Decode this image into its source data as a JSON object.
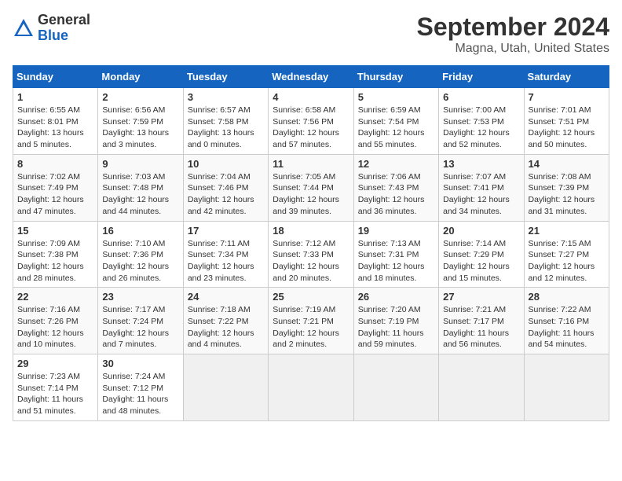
{
  "header": {
    "logo_general": "General",
    "logo_blue": "Blue",
    "month": "September 2024",
    "location": "Magna, Utah, United States"
  },
  "weekdays": [
    "Sunday",
    "Monday",
    "Tuesday",
    "Wednesday",
    "Thursday",
    "Friday",
    "Saturday"
  ],
  "weeks": [
    [
      {
        "day": "1",
        "sunrise": "6:55 AM",
        "sunset": "8:01 PM",
        "daylight": "13 hours and 5 minutes."
      },
      {
        "day": "2",
        "sunrise": "6:56 AM",
        "sunset": "7:59 PM",
        "daylight": "13 hours and 3 minutes."
      },
      {
        "day": "3",
        "sunrise": "6:57 AM",
        "sunset": "7:58 PM",
        "daylight": "13 hours and 0 minutes."
      },
      {
        "day": "4",
        "sunrise": "6:58 AM",
        "sunset": "7:56 PM",
        "daylight": "12 hours and 57 minutes."
      },
      {
        "day": "5",
        "sunrise": "6:59 AM",
        "sunset": "7:54 PM",
        "daylight": "12 hours and 55 minutes."
      },
      {
        "day": "6",
        "sunrise": "7:00 AM",
        "sunset": "7:53 PM",
        "daylight": "12 hours and 52 minutes."
      },
      {
        "day": "7",
        "sunrise": "7:01 AM",
        "sunset": "7:51 PM",
        "daylight": "12 hours and 50 minutes."
      }
    ],
    [
      {
        "day": "8",
        "sunrise": "7:02 AM",
        "sunset": "7:49 PM",
        "daylight": "12 hours and 47 minutes."
      },
      {
        "day": "9",
        "sunrise": "7:03 AM",
        "sunset": "7:48 PM",
        "daylight": "12 hours and 44 minutes."
      },
      {
        "day": "10",
        "sunrise": "7:04 AM",
        "sunset": "7:46 PM",
        "daylight": "12 hours and 42 minutes."
      },
      {
        "day": "11",
        "sunrise": "7:05 AM",
        "sunset": "7:44 PM",
        "daylight": "12 hours and 39 minutes."
      },
      {
        "day": "12",
        "sunrise": "7:06 AM",
        "sunset": "7:43 PM",
        "daylight": "12 hours and 36 minutes."
      },
      {
        "day": "13",
        "sunrise": "7:07 AM",
        "sunset": "7:41 PM",
        "daylight": "12 hours and 34 minutes."
      },
      {
        "day": "14",
        "sunrise": "7:08 AM",
        "sunset": "7:39 PM",
        "daylight": "12 hours and 31 minutes."
      }
    ],
    [
      {
        "day": "15",
        "sunrise": "7:09 AM",
        "sunset": "7:38 PM",
        "daylight": "12 hours and 28 minutes."
      },
      {
        "day": "16",
        "sunrise": "7:10 AM",
        "sunset": "7:36 PM",
        "daylight": "12 hours and 26 minutes."
      },
      {
        "day": "17",
        "sunrise": "7:11 AM",
        "sunset": "7:34 PM",
        "daylight": "12 hours and 23 minutes."
      },
      {
        "day": "18",
        "sunrise": "7:12 AM",
        "sunset": "7:33 PM",
        "daylight": "12 hours and 20 minutes."
      },
      {
        "day": "19",
        "sunrise": "7:13 AM",
        "sunset": "7:31 PM",
        "daylight": "12 hours and 18 minutes."
      },
      {
        "day": "20",
        "sunrise": "7:14 AM",
        "sunset": "7:29 PM",
        "daylight": "12 hours and 15 minutes."
      },
      {
        "day": "21",
        "sunrise": "7:15 AM",
        "sunset": "7:27 PM",
        "daylight": "12 hours and 12 minutes."
      }
    ],
    [
      {
        "day": "22",
        "sunrise": "7:16 AM",
        "sunset": "7:26 PM",
        "daylight": "12 hours and 10 minutes."
      },
      {
        "day": "23",
        "sunrise": "7:17 AM",
        "sunset": "7:24 PM",
        "daylight": "12 hours and 7 minutes."
      },
      {
        "day": "24",
        "sunrise": "7:18 AM",
        "sunset": "7:22 PM",
        "daylight": "12 hours and 4 minutes."
      },
      {
        "day": "25",
        "sunrise": "7:19 AM",
        "sunset": "7:21 PM",
        "daylight": "12 hours and 2 minutes."
      },
      {
        "day": "26",
        "sunrise": "7:20 AM",
        "sunset": "7:19 PM",
        "daylight": "11 hours and 59 minutes."
      },
      {
        "day": "27",
        "sunrise": "7:21 AM",
        "sunset": "7:17 PM",
        "daylight": "11 hours and 56 minutes."
      },
      {
        "day": "28",
        "sunrise": "7:22 AM",
        "sunset": "7:16 PM",
        "daylight": "11 hours and 54 minutes."
      }
    ],
    [
      {
        "day": "29",
        "sunrise": "7:23 AM",
        "sunset": "7:14 PM",
        "daylight": "11 hours and 51 minutes."
      },
      {
        "day": "30",
        "sunrise": "7:24 AM",
        "sunset": "7:12 PM",
        "daylight": "11 hours and 48 minutes."
      },
      null,
      null,
      null,
      null,
      null
    ]
  ]
}
